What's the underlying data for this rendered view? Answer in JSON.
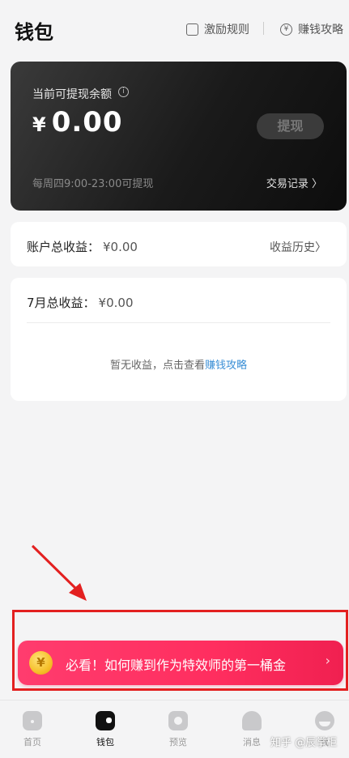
{
  "header": {
    "title": "钱包",
    "rules_label": "激励规则",
    "guide_label": "赚钱攻略"
  },
  "balance": {
    "label": "当前可提现余额",
    "currency": "¥",
    "amount": "0.00",
    "withdraw_label": "提现",
    "note": "每周四9:00-23:00可提现",
    "transactions_label": "交易记录 〉"
  },
  "total": {
    "label": "账户总收益：",
    "value": "¥0.00",
    "history_label": "收益历史〉"
  },
  "month": {
    "label": "7月总收益：",
    "value": "¥0.00",
    "empty_prefix": "暂无收益，点击查看",
    "empty_link": "赚钱攻略"
  },
  "banner": {
    "coin_symbol": "¥",
    "text": "必看！如何赚到作为特效师的第一桶金",
    "arrow": "›"
  },
  "tabs": [
    {
      "label": "首页"
    },
    {
      "label": "钱包"
    },
    {
      "label": "预览"
    },
    {
      "label": "消息"
    },
    {
      "label": "我"
    }
  ],
  "watermark": "知乎 @辰掌柜",
  "colors": {
    "accent": "#ff2e5f",
    "annotation": "#e32020",
    "link": "#3a8fd6"
  }
}
